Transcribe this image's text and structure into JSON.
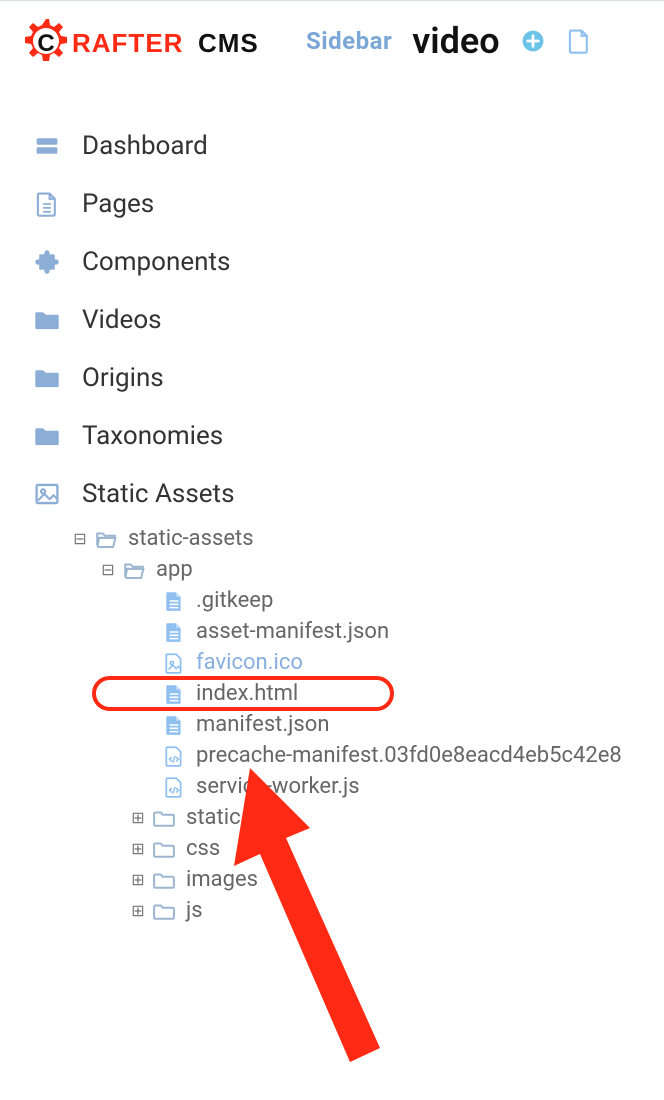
{
  "header": {
    "logo_text_1": "C",
    "logo_text_2": "RAFTER",
    "logo_text_3": "CMS",
    "sidebar_label": "Sidebar",
    "page_title": "video"
  },
  "nav": {
    "dashboard": "Dashboard",
    "pages": "Pages",
    "components": "Components",
    "videos": "Videos",
    "origins": "Origins",
    "taxonomies": "Taxonomies",
    "static_assets": "Static Assets"
  },
  "tree": {
    "static_assets": "static-assets",
    "app": "app",
    "files": {
      "gitkeep": ".gitkeep",
      "asset_manifest": "asset-manifest.json",
      "favicon": "favicon.ico",
      "index": "index.html",
      "manifest": "manifest.json",
      "precache": "precache-manifest.03fd0e8eacd4eb5c42e8",
      "service_worker": "service-worker.js"
    },
    "folders": {
      "static": "static",
      "css": "css",
      "images": "images",
      "js": "js"
    }
  }
}
